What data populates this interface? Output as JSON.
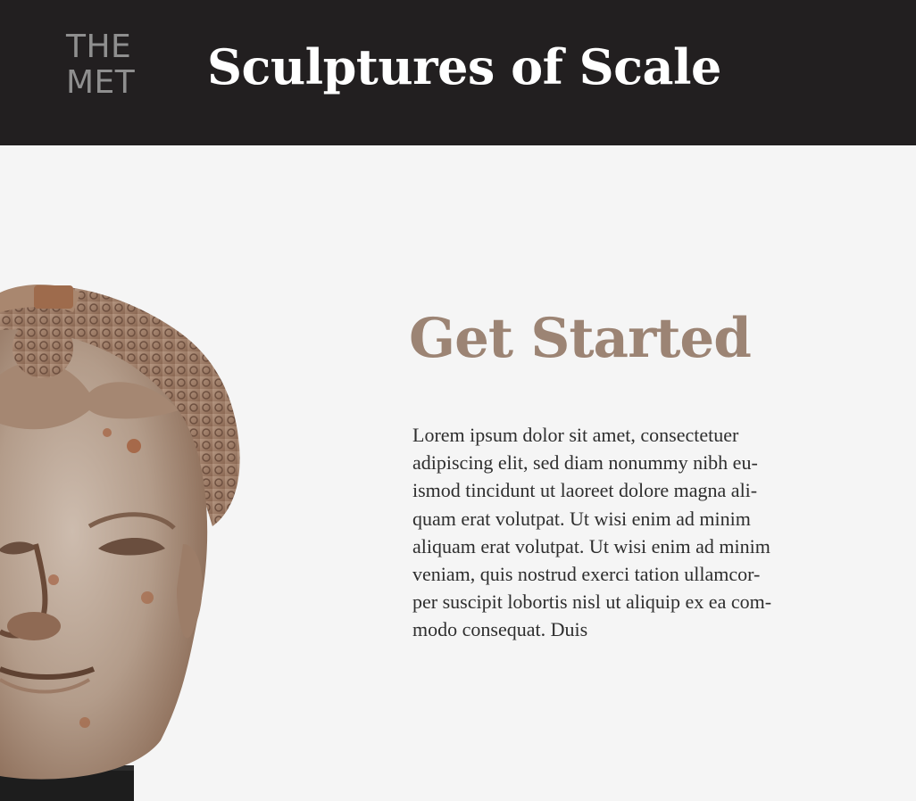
{
  "header": {
    "logo_line1": "THE",
    "logo_line2": "MET",
    "title": "Sculptures of Scale"
  },
  "main": {
    "image": {
      "subject": "sculpted stone head on a black pedestal"
    },
    "heading": "Get Started",
    "body_lines": [
      "Lorem ipsum dolor sit amet, consectetuer",
      "adipiscing elit, sed diam nonummy nibh eu-",
      "ismod tincidunt ut laoreet dolore magna ali-",
      "quam erat volutpat. Ut wisi enim ad minim",
      "aliquam erat volutpat. Ut wisi enim ad minim",
      "veniam, quis nostrud exerci tation ullamcor-",
      "per suscipit lobortis nisl ut aliquip ex ea com-",
      "modo consequat. Duis"
    ]
  },
  "colors": {
    "header_bg": "#221f20",
    "page_bg": "#f5f5f5",
    "logo": "#8f8f8f",
    "title": "#ffffff",
    "heading_accent": "#9c8474",
    "body_text": "#2e2e2e"
  }
}
